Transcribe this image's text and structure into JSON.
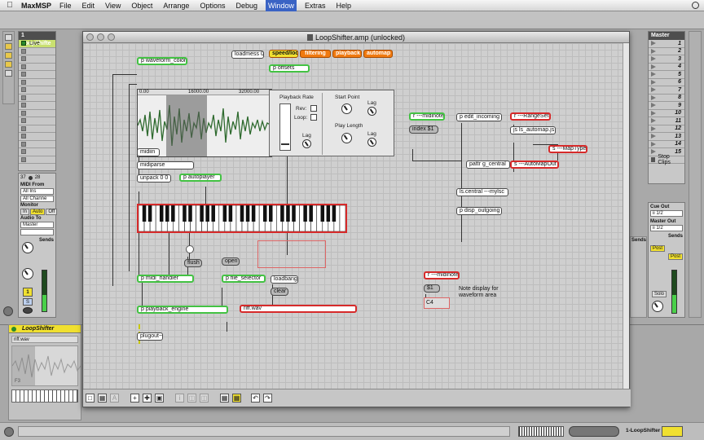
{
  "menubar": {
    "app": "MaxMSP",
    "items": [
      "File",
      "Edit",
      "View",
      "Object",
      "Arrange",
      "Options",
      "Debug",
      "Window",
      "Extras",
      "Help"
    ],
    "active_index": 7
  },
  "live": {
    "track_name": "1 LoopShifte",
    "clip_name": "Live",
    "master_name": "Master",
    "master_slots": [
      "1",
      "2",
      "3",
      "4",
      "5",
      "6",
      "7",
      "8",
      "9",
      "10",
      "11",
      "12",
      "13",
      "14",
      "15"
    ],
    "stop_clips": "Stop Clips",
    "tempo_left": "37",
    "tempo_right": "28",
    "midi_from": "MIDI From",
    "all_ins": "All Ins",
    "all_channels": "All Channe",
    "monitor": "Monitor",
    "monitor_in": "In",
    "monitor_auto": "Auto",
    "monitor_off": "Off",
    "audio_to": "Audio To",
    "audio_to_value": "Master",
    "sends": "Sends",
    "track_number": "1",
    "solo_label": "S",
    "cue_out": "Cue Out",
    "cue_out_value": "ii 1/2",
    "master_out": "Master Out",
    "master_out_value": "ii 1/2",
    "post": "Post",
    "solo": "Solo",
    "device_title": "LoopShifter",
    "device_file": "riff.wav",
    "device_note": "F3",
    "status_track": "1-LoopShifter"
  },
  "window": {
    "title": "LoopShifter.amp (unlocked)"
  },
  "patch": {
    "loadmess": "loadmess 0",
    "tabs": [
      "speed/loop",
      "filtering",
      "playback",
      "automap"
    ],
    "p_offsets": "p offsets",
    "p_waveform_color": "p waveform_color",
    "ruler_0": "0.00",
    "ruler_1": "16000.00",
    "ruler_2": "32000.00",
    "playback_rate": "Playback Rate",
    "rev": "Rev:",
    "loop": "Loop:",
    "lag": "Lag",
    "start_point": "Start Point",
    "play_length": "Play Length",
    "midiin": "midiin",
    "midiparse": "midiparse",
    "unpack": "unpack 0 0",
    "p_autoplayer": "p autoplayer",
    "r_midinote": "r ---midinote",
    "index": "index $1",
    "p_edit_incoming": "p edit_incoming",
    "r_rangeset": "r ---RangeSet",
    "js_automap": "js ls_automap.js",
    "s_maptype": "s ---MapType",
    "pattr": "pattr g_central",
    "s_automapout": "s ---AutoMapOut",
    "ls_central": "ls.central ---mylsc",
    "p_disp_outgoing": "p disp_outgoing",
    "flush": "flush",
    "open": "open",
    "p_midi_handler": "p midi_handler",
    "p_file_selector": "p file_selector",
    "loadbang": "loadbang",
    "clear": "clear",
    "p_playback_engine": "p playback_engine",
    "riff": "riff.wav",
    "plugout": "plugout~",
    "r_midinote2": "r ---midinote",
    "msg_1": "$1",
    "note_box": "C4",
    "comment_note": "Note display for waveform area"
  }
}
